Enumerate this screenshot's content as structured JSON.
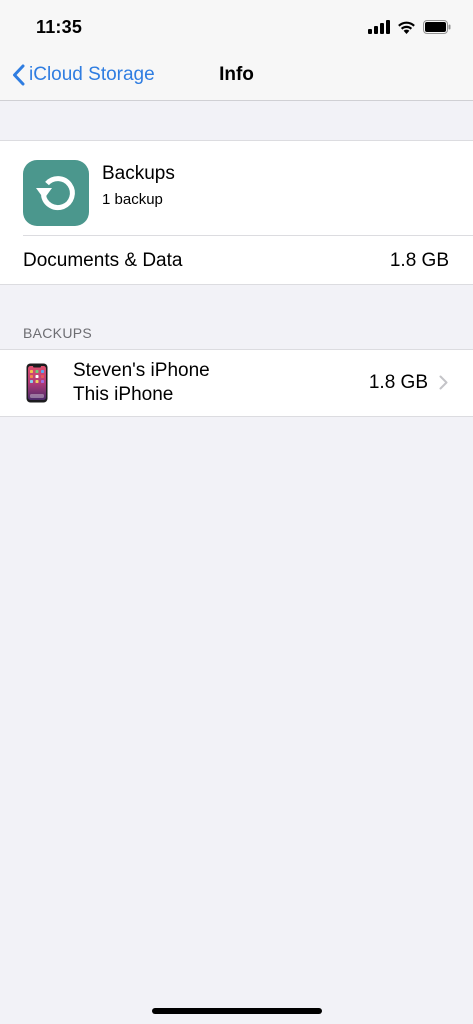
{
  "status_bar": {
    "time": "11:35",
    "icons": [
      "cellular-signal-icon",
      "wifi-icon",
      "battery-icon"
    ]
  },
  "nav": {
    "back_label": "iCloud Storage",
    "title": "Info"
  },
  "app": {
    "name": "Backups",
    "subtitle": "1 backup",
    "icon": "restore-arrow-icon",
    "icon_color": "#4b978d"
  },
  "documents_data": {
    "label": "Documents & Data",
    "value": "1.8 GB"
  },
  "backups_section": {
    "header": "BACKUPS",
    "items": [
      {
        "name": "Steven's iPhone",
        "subtitle": "This iPhone",
        "size": "1.8 GB",
        "icon": "iphone-icon"
      }
    ]
  },
  "colors": {
    "accent": "#2f7de1",
    "background": "#f2f2f7"
  }
}
